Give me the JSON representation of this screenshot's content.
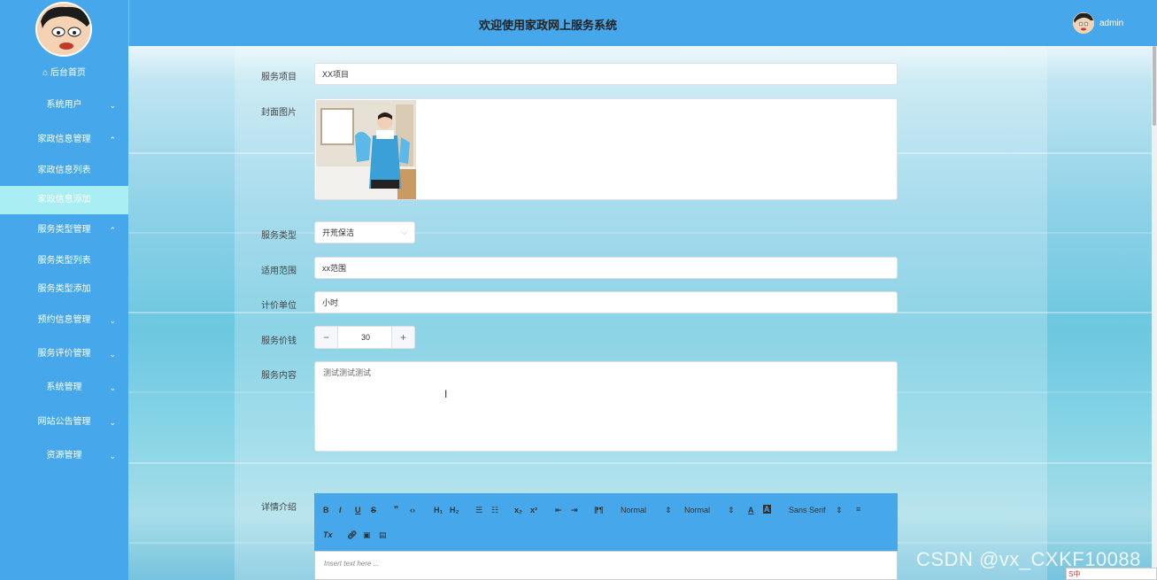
{
  "header": {
    "title": "欢迎使用家政网上服务系统",
    "username": "admin"
  },
  "sidebar": {
    "items": [
      {
        "label": "后台首页",
        "icon": "home-icon"
      },
      {
        "label": "系统用户",
        "expand": "chevron-down"
      },
      {
        "label": "家政信息管理",
        "expand": "chevron-up"
      },
      {
        "label": "家政信息列表"
      },
      {
        "label": "家政信息添加",
        "active": true
      },
      {
        "label": "服务类型管理",
        "expand": "chevron-up"
      },
      {
        "label": "服务类型列表"
      },
      {
        "label": "服务类型添加"
      },
      {
        "label": "预约信息管理",
        "expand": "chevron-down"
      },
      {
        "label": "服务评价管理",
        "expand": "chevron-down"
      },
      {
        "label": "系统管理",
        "expand": "chevron-down"
      },
      {
        "label": "网站公告管理",
        "expand": "chevron-down"
      },
      {
        "label": "资源管理",
        "expand": "chevron-down"
      }
    ]
  },
  "form": {
    "service_item": {
      "label": "服务项目",
      "value": "XX项目"
    },
    "cover": {
      "label": "封面图片"
    },
    "service_type": {
      "label": "服务类型",
      "value": "开荒保洁"
    },
    "scope": {
      "label": "适用范围",
      "value": "xx范围"
    },
    "unit": {
      "label": "计价单位",
      "value": "小时"
    },
    "price": {
      "label": "服务价钱",
      "value": "30",
      "minus": "−",
      "plus": "+"
    },
    "content": {
      "label": "服务内容",
      "value": "测试测试测试"
    },
    "detail": {
      "label": "详情介绍",
      "placeholder": "Insert text here ..."
    }
  },
  "toolbar": {
    "bold": "B",
    "italic": "I",
    "underline": "U",
    "strike": "S",
    "quote": "❞",
    "code": "‹›",
    "h1": "H₁",
    "h2": "H₂",
    "ol": "☰",
    "ul": "☷",
    "sub": "x₂",
    "sup": "x²",
    "outdent": "⇤",
    "indent": "⇥",
    "direction": "⁋¶",
    "size": "Normal",
    "header": "Normal",
    "font": "Sans Serif",
    "clean": "Tx",
    "align": "≡"
  },
  "overlay": {
    "watermark": "CSDN @vx_CXKF10088",
    "ime": "S中"
  },
  "colors": {
    "primary": "#46a7ea",
    "active_menu": "#a8eef2"
  }
}
